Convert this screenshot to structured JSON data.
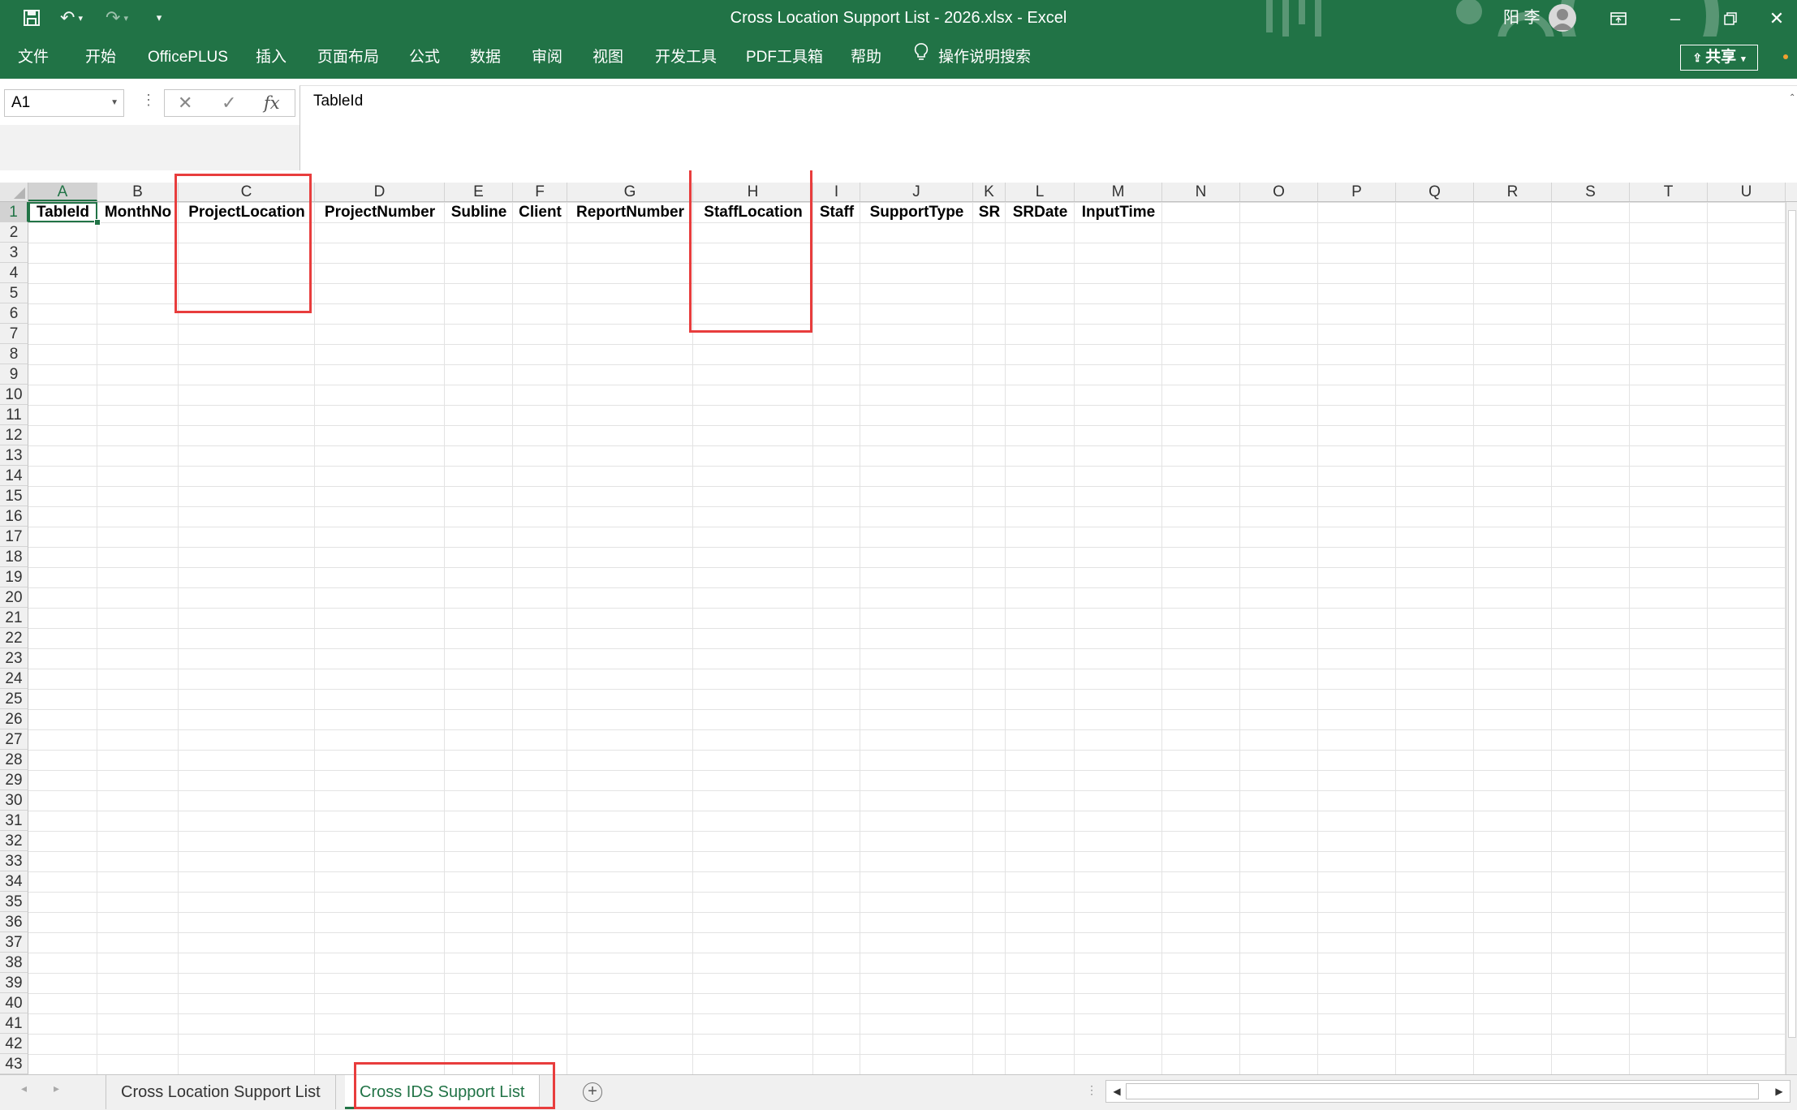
{
  "window": {
    "title": "Cross Location Support List - 2026.xlsx  -  Excel",
    "user_name": "阳 李",
    "share_label": "共享"
  },
  "ribbon": {
    "tabs": [
      "文件",
      "开始",
      "OfficePLUS",
      "插入",
      "页面布局",
      "公式",
      "数据",
      "审阅",
      "视图",
      "开发工具",
      "PDF工具箱",
      "帮助"
    ],
    "search_label": "操作说明搜索"
  },
  "formula_bar": {
    "name_box": "A1",
    "content": "TableId",
    "fx_label": "fx"
  },
  "grid": {
    "columns": [
      "A",
      "B",
      "C",
      "D",
      "E",
      "F",
      "G",
      "H",
      "I",
      "J",
      "K",
      "L",
      "M",
      "N",
      "O",
      "P",
      "Q",
      "R",
      "S",
      "T",
      "U"
    ],
    "rows": [
      "1",
      "2",
      "3",
      "4",
      "5",
      "6",
      "7",
      "8",
      "9",
      "10",
      "11",
      "12",
      "13",
      "14",
      "15",
      "16",
      "17",
      "18",
      "19",
      "20",
      "21",
      "22",
      "23",
      "24",
      "25",
      "26",
      "27",
      "28",
      "29",
      "30",
      "31",
      "32",
      "33",
      "34",
      "35",
      "36",
      "37",
      "38",
      "39",
      "40",
      "41",
      "42",
      "43"
    ],
    "header_row": [
      "TableId",
      "MonthNo",
      "ProjectLocation",
      "ProjectNumber",
      "Subline",
      "Client",
      "ReportNumber",
      "StaffLocation",
      "Staff",
      "SupportType",
      "SR",
      "SRDate",
      "InputTime"
    ],
    "selected_cell": "A1",
    "highlighted_columns": [
      "C",
      "H"
    ]
  },
  "sheets": {
    "tabs": [
      "Cross Location Support List",
      "Cross IDS Support List"
    ],
    "active": "Cross IDS Support List"
  },
  "colors": {
    "accent": "#217346",
    "highlight": "#e83d3d"
  }
}
